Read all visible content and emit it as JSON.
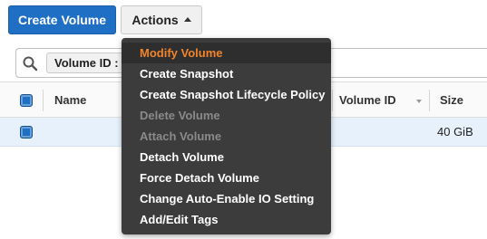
{
  "toolbar": {
    "create_label": "Create Volume",
    "actions_label": "Actions"
  },
  "search": {
    "filter_chip": "Volume ID : v"
  },
  "table": {
    "columns": [
      "Name",
      "Volume ID",
      "Size"
    ],
    "rows": [
      {
        "size": "40 GiB"
      }
    ]
  },
  "menu": {
    "items": [
      {
        "label": "Modify Volume",
        "state": "active"
      },
      {
        "label": "Create Snapshot",
        "state": "enabled"
      },
      {
        "label": "Create Snapshot Lifecycle Policy",
        "state": "enabled"
      },
      {
        "label": "Delete Volume",
        "state": "disabled"
      },
      {
        "label": "Attach Volume",
        "state": "disabled"
      },
      {
        "label": "Detach Volume",
        "state": "enabled"
      },
      {
        "label": "Force Detach Volume",
        "state": "enabled"
      },
      {
        "label": "Change Auto-Enable IO Setting",
        "state": "enabled"
      },
      {
        "label": "Add/Edit Tags",
        "state": "enabled"
      }
    ]
  },
  "colors": {
    "primary_button": "#1f6fc4",
    "menu_background": "#3c3c3c",
    "menu_active_text": "#f0842c",
    "selected_row": "#e7f1fb"
  }
}
